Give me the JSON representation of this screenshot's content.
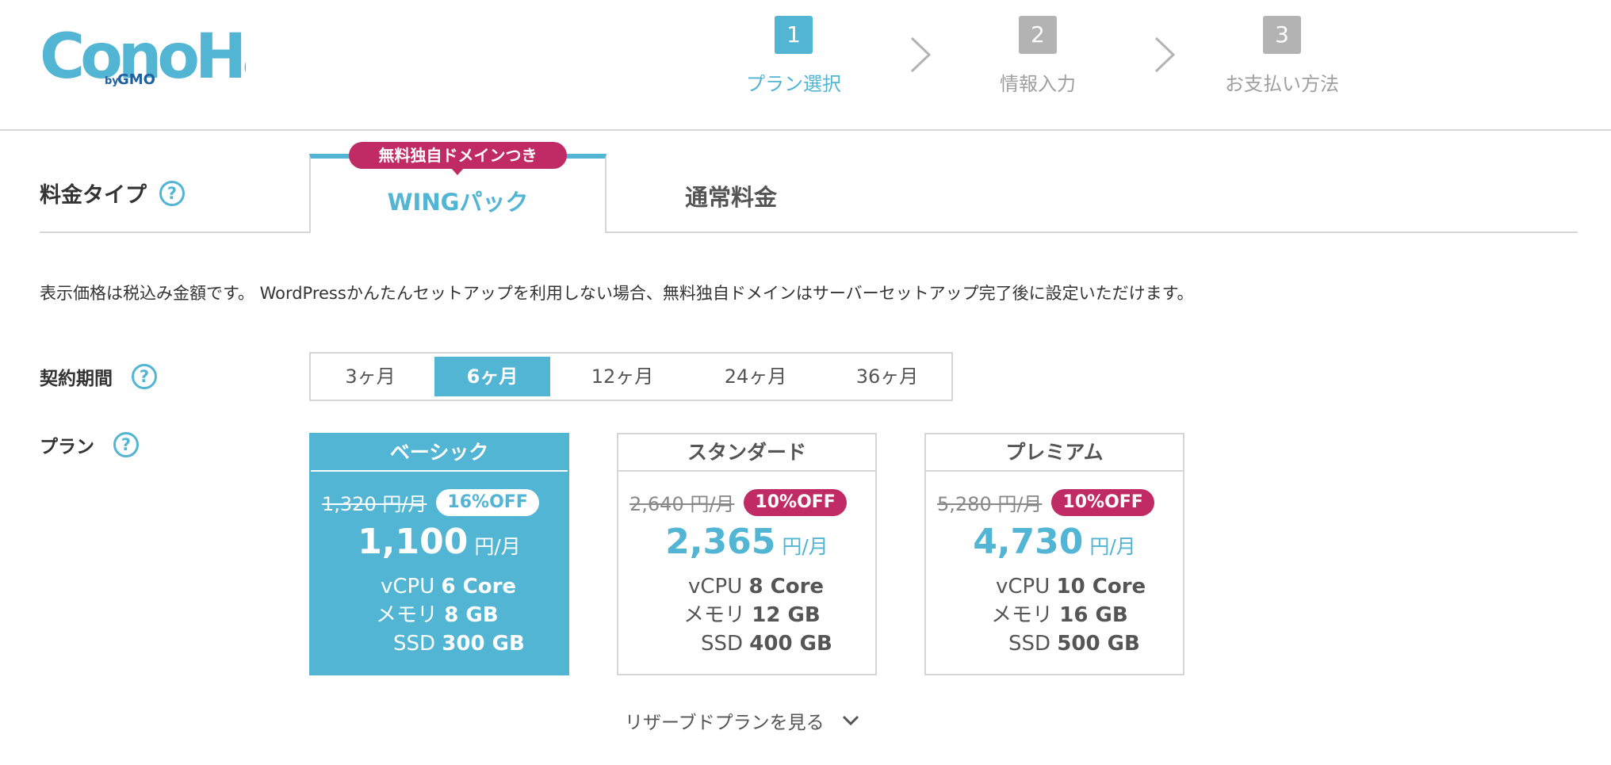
{
  "steps": [
    {
      "number": "1",
      "label": "プラン選択",
      "active": true
    },
    {
      "number": "2",
      "label": "情報入力",
      "active": false
    },
    {
      "number": "3",
      "label": "お支払い方法",
      "active": false
    }
  ],
  "pricing_type": {
    "label": "料金タイプ",
    "help": "?",
    "tabs": [
      {
        "label": "WINGパック",
        "ribbon": "無料独自ドメインつき",
        "active": true
      },
      {
        "label": "通常料金",
        "active": false
      }
    ]
  },
  "notice": "表示価格は税込み金額です。 WordPressかんたんセットアップを利用しない場合、無料独自ドメインはサーバーセットアップ完了後に設定いただけます。",
  "contract_period": {
    "label": "契約期間",
    "help": "?",
    "options": [
      "3ヶ月",
      "6ヶ月",
      "12ヶ月",
      "24ヶ月",
      "36ヶ月"
    ],
    "selected": "6ヶ月"
  },
  "plan_section": {
    "label": "プラン",
    "help": "?",
    "plans": [
      {
        "name": "ベーシック",
        "old_price": "1,320 円/月",
        "discount": "16%OFF",
        "price": "1,100",
        "unit": "円/月",
        "vcpu_label": "vCPU",
        "vcpu": "6 Core",
        "memory_label": "メモリ",
        "memory": "8 GB",
        "ssd_label": "SSD",
        "ssd": "300 GB",
        "selected": true
      },
      {
        "name": "スタンダード",
        "old_price": "2,640 円/月",
        "discount": "10%OFF",
        "price": "2,365",
        "unit": "円/月",
        "vcpu_label": "vCPU",
        "vcpu": "8 Core",
        "memory_label": "メモリ",
        "memory": "12 GB",
        "ssd_label": "SSD",
        "ssd": "400 GB",
        "selected": false
      },
      {
        "name": "プレミアム",
        "old_price": "5,280 円/月",
        "discount": "10%OFF",
        "price": "4,730",
        "unit": "円/月",
        "vcpu_label": "vCPU",
        "vcpu": "10 Core",
        "memory_label": "メモリ",
        "memory": "16 GB",
        "ssd_label": "SSD",
        "ssd": "500 GB",
        "selected": false
      }
    ]
  },
  "reserved_link": "リザーブドプランを見る",
  "colors": {
    "accent": "#52b5d3",
    "badge": "#c12b65",
    "border": "#d6d6d6",
    "muted": "#b3b3b3"
  },
  "icons": {
    "logo": "conoha-logo",
    "arrow": "chevron-right-icon",
    "expand": "chevron-down-icon",
    "help": "question-circle-icon"
  }
}
